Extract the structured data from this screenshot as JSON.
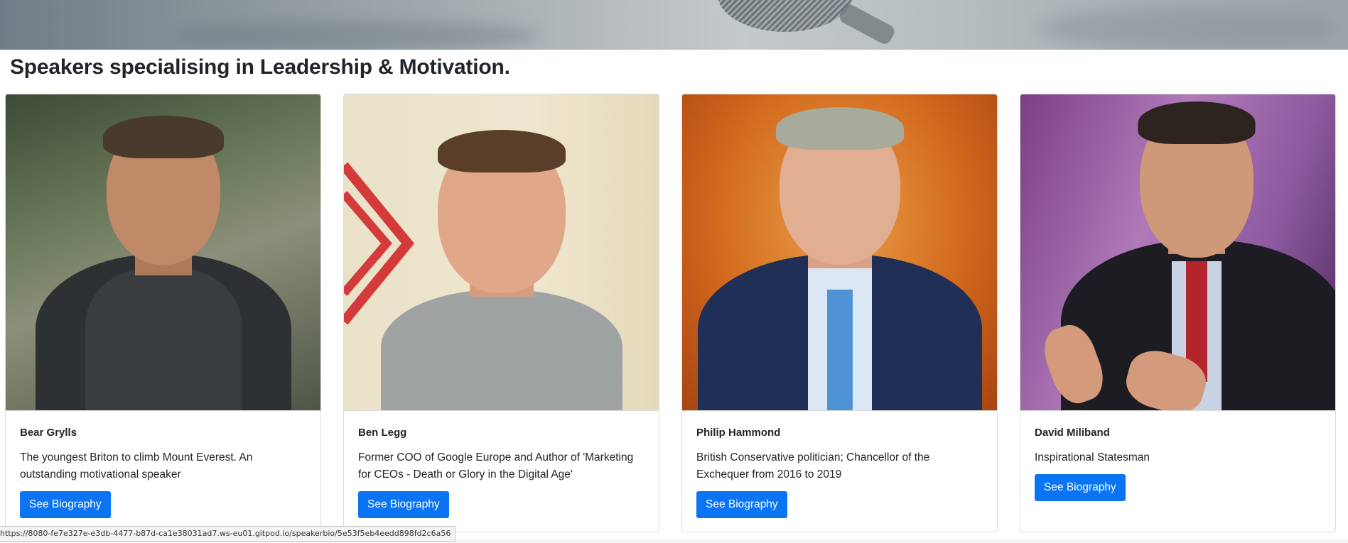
{
  "page": {
    "title": "Speakers specialising in Leadership & Motivation."
  },
  "speakers": [
    {
      "name": "Bear Grylls",
      "description": "The youngest Briton to climb Mount Everest. An outstanding motivational speaker",
      "button_label": "See Biography"
    },
    {
      "name": "Ben Legg",
      "description": "Former COO of Google Europe and Author of 'Marketing for CEOs - Death or Glory in the Digital Age'",
      "button_label": "See Biography"
    },
    {
      "name": "Philip Hammond",
      "description": "British Conservative politician; Chancellor of the Exchequer from 2016 to 2019",
      "button_label": "See Biography"
    },
    {
      "name": "David Miliband",
      "description": "Inspirational Statesman",
      "button_label": "See Biography"
    }
  ],
  "status_bar": {
    "url": "https://8080-fe7e327e-e3db-4477-b87d-ca1e38031ad7.ws-eu01.gitpod.io/speakerbio/5e53f5eb4eedd898fd2c6a56"
  },
  "colors": {
    "button_bg": "#0a74f2",
    "button_text": "#ffffff",
    "title_text": "#212529"
  }
}
